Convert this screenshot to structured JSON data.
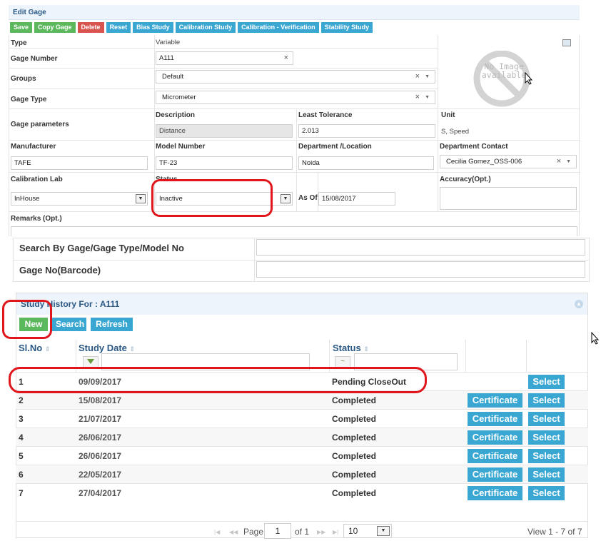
{
  "panel": {
    "title": "Edit Gage"
  },
  "toolbar": {
    "save": "Save",
    "copy": "Copy Gage",
    "delete": "Delete",
    "reset": "Reset",
    "bias": "Bias Study",
    "calibration": "Calibration Study",
    "verification": "Calibration - Verification",
    "stability": "Stability Study"
  },
  "form": {
    "type_label": "Type",
    "type_value": "Variable",
    "gage_number_label": "Gage Number",
    "gage_number_value": "A111",
    "groups_label": "Groups",
    "groups_value": "Default",
    "gage_type_label": "Gage Type",
    "gage_type_value": "Micrometer",
    "gage_params_label": "Gage parameters",
    "description_label": "Description",
    "description_value": "Distance",
    "least_tolerance_label": "Least Tolerance",
    "least_tolerance_value": "2.013",
    "unit_label": "Unit",
    "unit_value": "S, Speed",
    "manufacturer_label": "Manufacturer",
    "manufacturer_value": "TAFE",
    "model_label": "Model Number",
    "model_value": "TF-23",
    "department_label": "Department /Location",
    "department_value": "Noida",
    "contact_label": "Department Contact",
    "contact_value": "Cecilia Gomez_OSS-006",
    "cal_lab_label": "Calibration Lab",
    "cal_lab_value": "InHouse",
    "status_label": "Status",
    "status_value": "Inactive",
    "as_of_label": "As Of",
    "as_of_value": "15/08/2017",
    "accuracy_label": "Accuracy(Opt.)",
    "remarks_label": "Remarks (Opt.)",
    "no_image_line1": "No Image",
    "no_image_line2": "available"
  },
  "search": {
    "by_gage_label": "Search By Gage/Gage Type/Model No",
    "barcode_label": "Gage No(Barcode)"
  },
  "history": {
    "title": "Study History For : A111",
    "new": "New",
    "search": "Search",
    "refresh": "Refresh",
    "col_slno": "Sl.No",
    "col_date": "Study Date",
    "col_status": "Status",
    "certificate": "Certificate",
    "select": "Select",
    "rows": [
      {
        "slno": "1",
        "date": "09/09/2017",
        "status": "Pending CloseOut"
      },
      {
        "slno": "2",
        "date": "15/08/2017",
        "status": "Completed"
      },
      {
        "slno": "3",
        "date": "21/07/2017",
        "status": "Completed"
      },
      {
        "slno": "4",
        "date": "26/06/2017",
        "status": "Completed"
      },
      {
        "slno": "5",
        "date": "26/06/2017",
        "status": "Completed"
      },
      {
        "slno": "6",
        "date": "22/05/2017",
        "status": "Completed"
      },
      {
        "slno": "7",
        "date": "27/04/2017",
        "status": "Completed"
      }
    ]
  },
  "pager": {
    "page_label": "Page",
    "page_value": "1",
    "of_label": "of 1",
    "page_size": "10",
    "view_text": "View 1 - 7 of 7"
  },
  "colors": {
    "green": "#5cb85c",
    "red": "#d9534f",
    "blue": "#3aa7d3",
    "title": "#2a5885",
    "annotation": "#e0161c"
  }
}
